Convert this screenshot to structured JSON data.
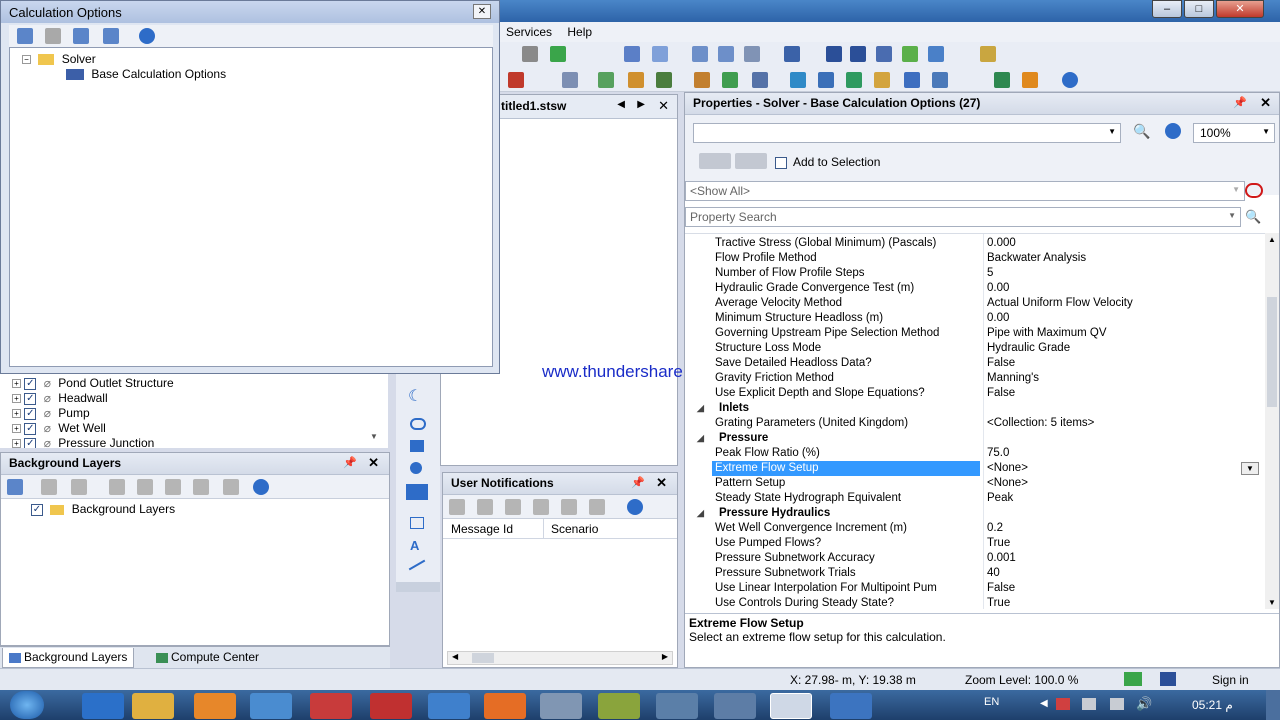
{
  "app": {
    "menus": [
      "Services",
      "Help"
    ]
  },
  "calc_dialog": {
    "title": "Calculation Options",
    "tree": {
      "root": "Solver",
      "child": "Base Calculation Options"
    }
  },
  "element_tree": {
    "items": [
      "Pond Outlet Structure",
      "Headwall",
      "Pump",
      "Wet Well",
      "Pressure Junction"
    ]
  },
  "background_layers": {
    "title": "Background Layers",
    "root": "Background Layers"
  },
  "bottom_tabs": {
    "tab1": "Background Layers",
    "tab2": "Compute Center"
  },
  "document_tab": "titled1.stsw",
  "watermark": "www.thundershare.net",
  "notifications": {
    "title": "User Notifications",
    "columns": [
      "Message Id",
      "Scenario"
    ]
  },
  "properties": {
    "title": "Properties - Solver - Base Calculation Options (27)",
    "zoom": "100%",
    "add_to_selection": "Add to Selection",
    "filter": "<Show All>",
    "search_placeholder": "Property Search",
    "rows": [
      {
        "type": "prop",
        "name": "Tractive Stress (Global Minimum) (Pascals)",
        "value": "0.000"
      },
      {
        "type": "prop",
        "name": "Flow Profile Method",
        "value": "Backwater Analysis"
      },
      {
        "type": "prop",
        "name": "Number of Flow Profile Steps",
        "value": "5"
      },
      {
        "type": "prop",
        "name": "Hydraulic Grade Convergence Test (m)",
        "value": "0.00"
      },
      {
        "type": "prop",
        "name": "Average Velocity Method",
        "value": "Actual Uniform Flow Velocity"
      },
      {
        "type": "prop",
        "name": "Minimum Structure Headloss (m)",
        "value": "0.00"
      },
      {
        "type": "prop",
        "name": "Governing Upstream Pipe Selection Method",
        "value": "Pipe with Maximum QV"
      },
      {
        "type": "prop",
        "name": "Structure Loss Mode",
        "value": "Hydraulic Grade"
      },
      {
        "type": "prop",
        "name": "Save Detailed Headloss Data?",
        "value": "False"
      },
      {
        "type": "prop",
        "name": "Gravity Friction Method",
        "value": "Manning's"
      },
      {
        "type": "prop",
        "name": "Use Explicit Depth and Slope Equations?",
        "value": "False"
      },
      {
        "type": "cat",
        "name": "Inlets",
        "value": ""
      },
      {
        "type": "prop",
        "name": "Grating Parameters (United Kingdom)",
        "value": "<Collection: 5 items>"
      },
      {
        "type": "cat",
        "name": "Pressure",
        "value": ""
      },
      {
        "type": "prop",
        "name": "Peak Flow Ratio (%)",
        "value": "75.0"
      },
      {
        "type": "sel",
        "name": "Extreme Flow Setup",
        "value": "<None>"
      },
      {
        "type": "prop",
        "name": "Pattern Setup",
        "value": "<None>"
      },
      {
        "type": "prop",
        "name": "Steady State Hydrograph Equivalent",
        "value": "Peak"
      },
      {
        "type": "cat",
        "name": "Pressure Hydraulics",
        "value": ""
      },
      {
        "type": "prop",
        "name": "Wet Well Convergence Increment (m)",
        "value": "0.2"
      },
      {
        "type": "prop",
        "name": "Use Pumped Flows?",
        "value": "True"
      },
      {
        "type": "prop",
        "name": "Pressure Subnetwork Accuracy",
        "value": "0.001"
      },
      {
        "type": "prop",
        "name": "Pressure Subnetwork Trials",
        "value": "40"
      },
      {
        "type": "prop",
        "name": "Use Linear Interpolation For Multipoint Pum",
        "value": "False"
      },
      {
        "type": "prop",
        "name": "Use Controls During Steady State?",
        "value": "True"
      }
    ],
    "help_title": "Extreme Flow Setup",
    "help_text": "Select an extreme flow setup for this calculation."
  },
  "status": {
    "coords": "X: 27.98- m, Y: 19.38 m",
    "zoom": "Zoom Level: 100.0 %",
    "sign_in": "Sign in"
  },
  "taskbar": {
    "lang": "EN",
    "time": "05:21 م"
  },
  "colors": {
    "selection": "#3399ff",
    "accent": "#2d63a8"
  }
}
